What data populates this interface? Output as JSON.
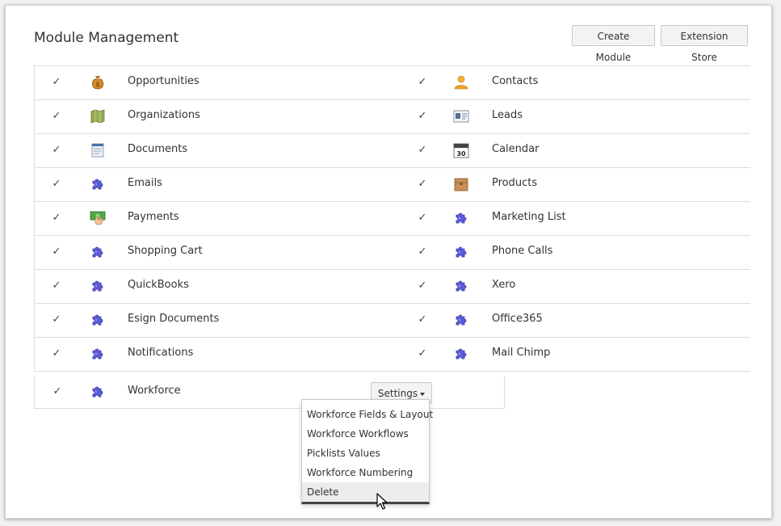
{
  "page": {
    "title": "Module Management"
  },
  "header_buttons": {
    "create": "Create Module",
    "store": "Extension Store"
  },
  "modules": [
    {
      "left": {
        "label": "Opportunities",
        "icon": "money-bag-icon"
      },
      "right": {
        "label": "Contacts",
        "icon": "person-icon"
      }
    },
    {
      "left": {
        "label": "Organizations",
        "icon": "map-icon"
      },
      "right": {
        "label": "Leads",
        "icon": "id-card-icon"
      }
    },
    {
      "left": {
        "label": "Documents",
        "icon": "document-icon"
      },
      "right": {
        "label": "Calendar",
        "icon": "calendar-icon"
      }
    },
    {
      "left": {
        "label": "Emails",
        "icon": "puzzle-icon"
      },
      "right": {
        "label": "Products",
        "icon": "box-icon"
      }
    },
    {
      "left": {
        "label": "Payments",
        "icon": "payment-icon"
      },
      "right": {
        "label": "Marketing List",
        "icon": "puzzle-icon"
      }
    },
    {
      "left": {
        "label": "Shopping Cart",
        "icon": "puzzle-icon"
      },
      "right": {
        "label": "Phone Calls",
        "icon": "puzzle-icon"
      }
    },
    {
      "left": {
        "label": "QuickBooks",
        "icon": "puzzle-icon"
      },
      "right": {
        "label": "Xero",
        "icon": "puzzle-icon"
      }
    },
    {
      "left": {
        "label": "Esign Documents",
        "icon": "puzzle-icon"
      },
      "right": {
        "label": "Office365",
        "icon": "puzzle-icon"
      }
    },
    {
      "left": {
        "label": "Notifications",
        "icon": "puzzle-icon"
      },
      "right": {
        "label": "Mail Chimp",
        "icon": "puzzle-icon"
      }
    }
  ],
  "last_module": {
    "label": "Workforce",
    "icon": "puzzle-icon",
    "settings_label": "Settings"
  },
  "calendar_icon_text": "30",
  "settings_menu": [
    "Workforce Fields & Layout",
    "Workforce Workflows",
    "Picklists Values",
    "Workforce Numbering",
    "Delete"
  ],
  "checkmark": "✓",
  "colors": {
    "puzzle": "#5b5bd6",
    "border": "#dddddd",
    "highlight": "#ececec"
  }
}
